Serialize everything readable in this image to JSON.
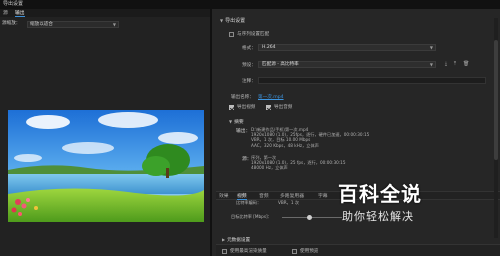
{
  "window": {
    "title": "导出设置"
  },
  "left_panel": {
    "tabs": [
      "源",
      "输出"
    ],
    "active_tab": 1,
    "scale_label": "源缩放：",
    "scale_value": "缩放以适合"
  },
  "export_settings": {
    "section_title": "导出设置",
    "match_sequence_label": "与序列设置匹配",
    "format_label": "格式：",
    "format_value": "H.264",
    "preset_label": "预设：",
    "preset_value": "匹配源 - 高比特率",
    "comments_label": "注释：",
    "output_name_label": "输出名称：",
    "output_name_value": "第一次.mp4",
    "export_video_label": "导出视频",
    "export_audio_label": "导出音频"
  },
  "summary": {
    "title": "摘要",
    "output_label": "输出：",
    "output_lines": [
      "D:\\新建作品\\手机\\第一次.mp4",
      "1920x1080 (1.0)，25fps，逐行，硬件已加速，00:00:30:15",
      "VBR，1 次，目标 10.00 Mbps",
      "AAC，320 Kbps，48 kHz，立体声"
    ],
    "source_label": "源：",
    "source_lines": [
      "序列，第一次",
      "1920x1080 (1.0)，25 fps，逐行，00:00:30:15",
      "48000 Hz，立体声"
    ]
  },
  "bottom_tabs": {
    "items": [
      "效果",
      "视频",
      "音频",
      "多路复用器",
      "字幕"
    ],
    "active": 1
  },
  "bitrate": {
    "encoding_label": "比特率编码：",
    "encoding_value": "VBR，1 次",
    "target_label": "目标比特率 [Mbps]："
  },
  "bottom_checks": {
    "max_depth_label": "使用最高渲染质量",
    "preview_label": "使用预览"
  },
  "advanced": {
    "label": "元数据设置"
  },
  "watermark": {
    "title": "百科全说",
    "subtitle": "助你轻松解决"
  }
}
